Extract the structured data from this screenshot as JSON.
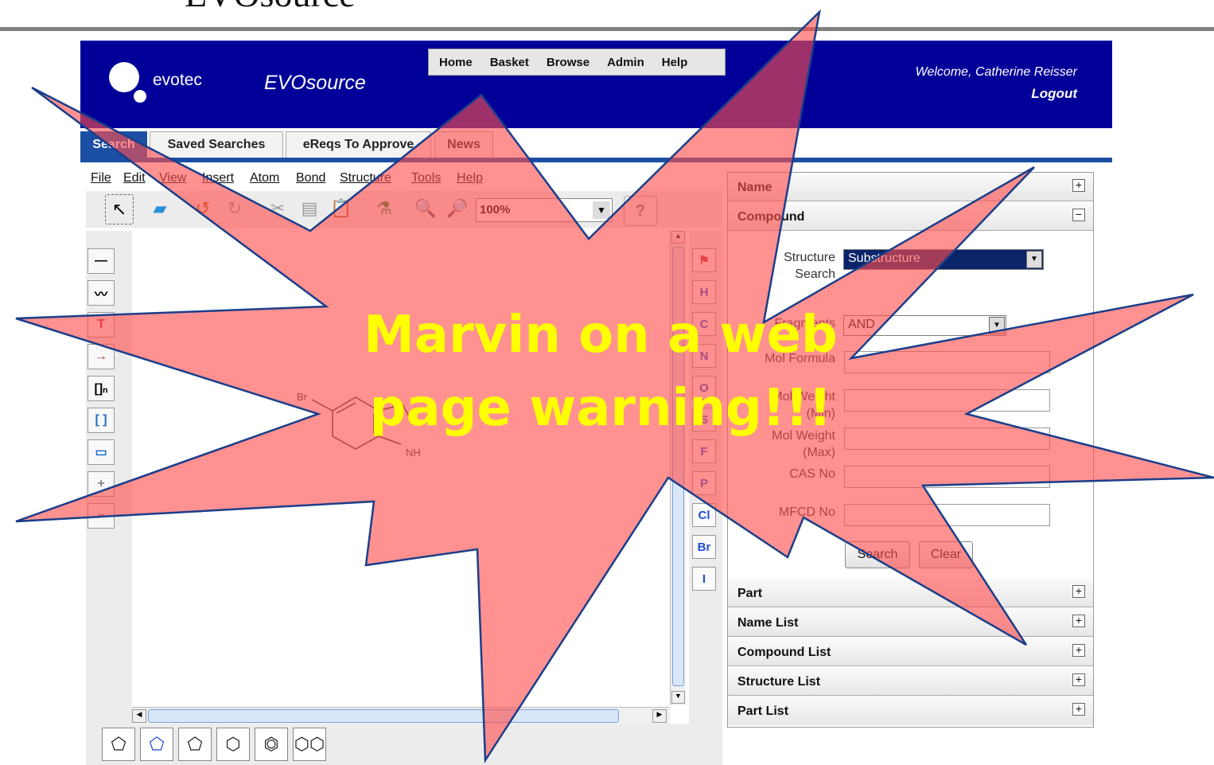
{
  "slide": {
    "title": "EVOsource"
  },
  "header": {
    "logo_text": "evotec",
    "app_name": "EVOsource",
    "nav": [
      "Home",
      "Basket",
      "Browse",
      "Admin",
      "Help"
    ],
    "welcome": "Welcome, Catherine Reisser",
    "logout": "Logout"
  },
  "tabs": [
    {
      "label": "Search",
      "active": true
    },
    {
      "label": "Saved Searches",
      "active": false
    },
    {
      "label": "eReqs To Approve",
      "active": false
    },
    {
      "label": "News",
      "active": false
    }
  ],
  "editor": {
    "menu": [
      "File",
      "Edit",
      "View",
      "Insert",
      "Atom",
      "Bond",
      "Structure",
      "Tools",
      "Help"
    ],
    "zoom": "100%",
    "atoms": [
      "H",
      "C",
      "N",
      "O",
      "S",
      "F",
      "P",
      "Cl",
      "Br",
      "I"
    ],
    "molecule_labels": {
      "br": "Br",
      "nh": "NH"
    }
  },
  "panel": {
    "sections": {
      "name": "Name",
      "compound": "Compound",
      "part": "Part",
      "name_list": "Name List",
      "compound_list": "Compound List",
      "structure_list": "Structure List",
      "part_list": "Part List"
    },
    "fields": {
      "structure_search_label_1": "Structure",
      "structure_search_label_2": "Search",
      "structure_search_value": "Substructure",
      "fragments_label": "Fragments",
      "fragments_value": "AND",
      "mol_formula": "Mol Formula",
      "mol_weight_min_1": "Mol Weight",
      "mol_weight_min_2": "(Min)",
      "mol_weight_max_1": "Mol Weight",
      "mol_weight_max_2": "(Max)",
      "cas_no": "CAS No",
      "mfcd_no": "MFCD No"
    },
    "buttons": {
      "search": "Search",
      "clear": "Clear"
    },
    "expand_symbol": "+",
    "collapse_symbol": "−"
  },
  "overlay": {
    "line1": "Marvin on a web",
    "line2": "page warning!!!",
    "fill_color": "#ff4d4d",
    "text_color": "#ffff00"
  }
}
